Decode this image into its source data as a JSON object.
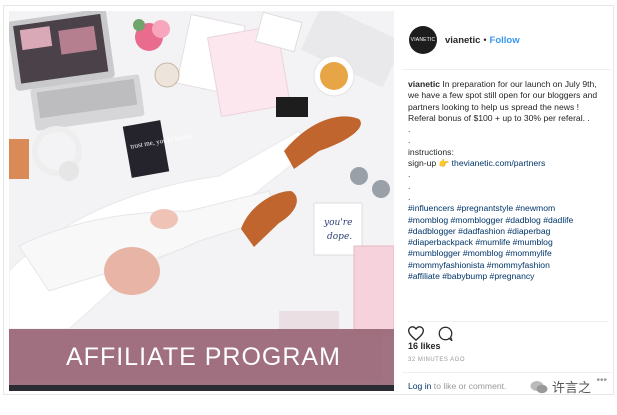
{
  "photo": {
    "banner_text": "AFFILIATE PROGRAM",
    "card_left_text": "trust me, you're lovely",
    "card_right_text": "you're dope."
  },
  "header": {
    "avatar_text": "VIANETIC",
    "username": "vianetic",
    "separator": "•",
    "follow_label": "Follow"
  },
  "caption": {
    "username": "vianetic",
    "text": "In preparation for our launch on July 9th, we have a few spot still open for our bloggers and partners looking to help us spread the news ! Referal bonus of $100 + up to 30% per referal. .",
    "dots1": ".",
    "dots2": ".",
    "instructions": "instructions:",
    "signup_label": "sign-up",
    "signup_emoji": "👉",
    "signup_link": "thevianetic.com/partners",
    "dots3": ".",
    "dots4": ".",
    "dots5": ".",
    "tags": [
      "#influencers #pregnantstyle #newmom",
      "#momblog #momblogger #dadblog #dadlife",
      "#dadblogger #dadfashion #diaperbag",
      "#diaperbackpack #mumlife #mumblog",
      "#mumblogger #momblog #mommylife",
      "#mommyfashionista #mommyfashion",
      "#affiliate #babybump #pregnancy"
    ]
  },
  "stats": {
    "likes": "16 likes",
    "time": "32 MINUTES AGO"
  },
  "footer": {
    "login_link": "Log in",
    "login_rest": " to like or comment.",
    "more": "•••"
  },
  "watermark": {
    "text": "许言之"
  },
  "colors": {
    "banner": "#9c6a7a",
    "link": "#003569",
    "follow": "#3897f0",
    "shoe": "#c0652e"
  }
}
